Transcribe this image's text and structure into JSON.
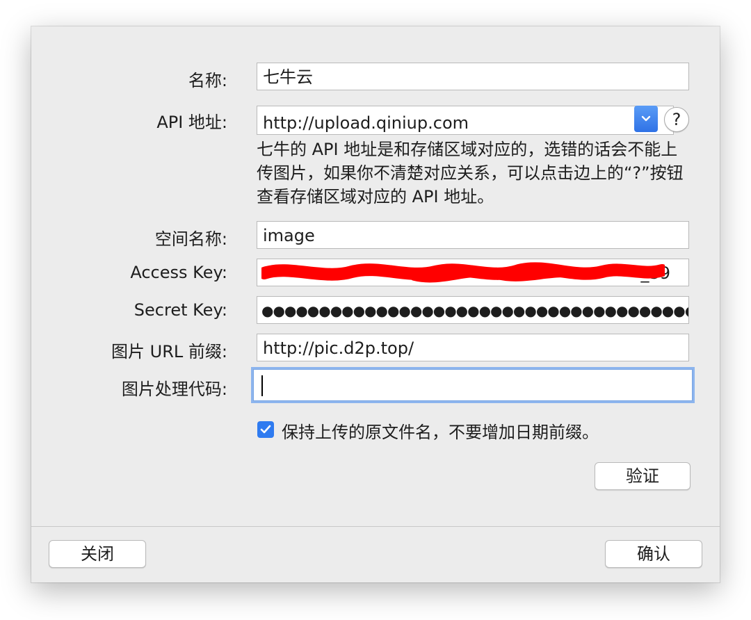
{
  "form": {
    "name_label": "名称:",
    "name_value": "七牛云",
    "api_label": "API 地址:",
    "api_value": "http://upload.qiniup.com",
    "help_label": "?",
    "api_description": "七牛的 API 地址是和存储区域对应的，选错的话会不能上传图片，如果你不清楚对应关系，可以点击边上的“?”按钮查看存储区域对应的 API 地址。",
    "space_label": "空间名称:",
    "space_value": "image",
    "access_label": "Access Key:",
    "access_value_visible": "_39",
    "secret_label": "Secret Key:",
    "secret_value": "●●●●●●●●●●●●●●●●●●●●●●●●●●●●●●●●●●●●●●●●●●●",
    "url_prefix_label": "图片 URL 前缀:",
    "url_prefix_value": "http://pic.d2p.top/",
    "process_label": "图片处理代码:",
    "process_value": "",
    "keep_name_label": "保持上传的原文件名，不要增加日期前缀。",
    "keep_name_checked": true,
    "verify_label": "验证"
  },
  "footer": {
    "close_label": "关闭",
    "confirm_label": "确认"
  },
  "colors": {
    "accent": "#2f7bf0",
    "redaction": "#ff0000"
  },
  "icons": {
    "dropdown": "chevron-down-icon",
    "checkbox": "checkmark-icon"
  }
}
